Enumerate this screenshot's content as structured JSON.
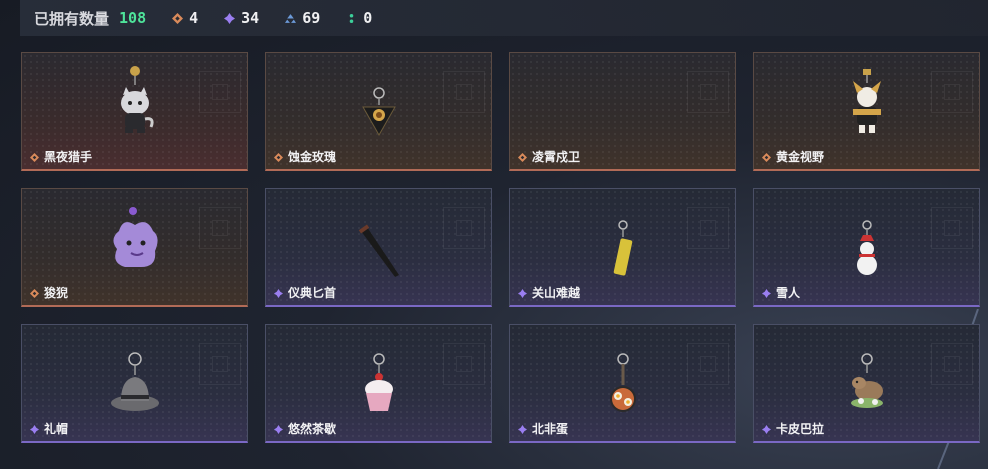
{
  "header": {
    "owned_label": "已拥有数量",
    "owned_count": "108",
    "stats": [
      {
        "icon": "orange-diamond-icon",
        "color": "#d98a5a",
        "value": "4"
      },
      {
        "icon": "purple-diamond-icon",
        "color": "#9a7ef0",
        "value": "34"
      },
      {
        "icon": "blue-triangle-icon",
        "color": "#6c9ad8",
        "value": "69"
      },
      {
        "icon": "green-dots-icon",
        "color": "#3ccf9a",
        "value": "0"
      }
    ]
  },
  "colors": {
    "orange_rarity": "#d98a5a",
    "purple_rarity": "#9a7ef0",
    "owned_count": "#4ee39a"
  },
  "items": [
    {
      "name": "黑夜猎手",
      "rarity": "orange",
      "icon": "black-night-hunter-charm-icon"
    },
    {
      "name": "蚀金玫瑰",
      "rarity": "orange",
      "icon": "golden-rose-charm-icon"
    },
    {
      "name": "凌霄戍卫",
      "rarity": "orange",
      "icon": "sky-guard-charm-icon"
    },
    {
      "name": "黄金视野",
      "rarity": "orange",
      "icon": "golden-vision-charm-icon"
    },
    {
      "name": "狻猊",
      "rarity": "orange",
      "icon": "suanni-lion-charm-icon"
    },
    {
      "name": "仪典匕首",
      "rarity": "purple",
      "icon": "ceremonial-dagger-charm-icon"
    },
    {
      "name": "关山难越",
      "rarity": "purple",
      "icon": "golden-bar-charm-icon"
    },
    {
      "name": "雪人",
      "rarity": "purple",
      "icon": "snowman-charm-icon"
    },
    {
      "name": "礼帽",
      "rarity": "purple",
      "icon": "fedora-hat-charm-icon"
    },
    {
      "name": "悠然茶歇",
      "rarity": "purple",
      "icon": "cupcake-charm-icon"
    },
    {
      "name": "北非蛋",
      "rarity": "purple",
      "icon": "shakshuka-pan-charm-icon"
    },
    {
      "name": "卡皮巴拉",
      "rarity": "purple",
      "icon": "capybara-charm-icon"
    }
  ]
}
